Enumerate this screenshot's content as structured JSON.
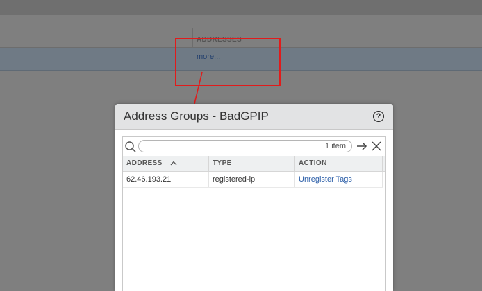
{
  "background": {
    "column_header": "ADDRESSES",
    "more_link": "more..."
  },
  "dialog": {
    "title": "Address Groups - BadGPIP",
    "help_icon": "?",
    "search": {
      "placeholder": "",
      "value": "",
      "count_label": "1 item"
    },
    "columns": [
      {
        "label": "ADDRESS",
        "sorted": "ascending"
      },
      {
        "label": "TYPE"
      },
      {
        "label": "ACTION"
      }
    ],
    "rows": [
      {
        "address": "62.46.193.21",
        "type": "registered-ip",
        "action": "Unregister Tags"
      }
    ]
  },
  "colors": {
    "annotation": "#e11b1b",
    "link": "#2b5ea8"
  }
}
